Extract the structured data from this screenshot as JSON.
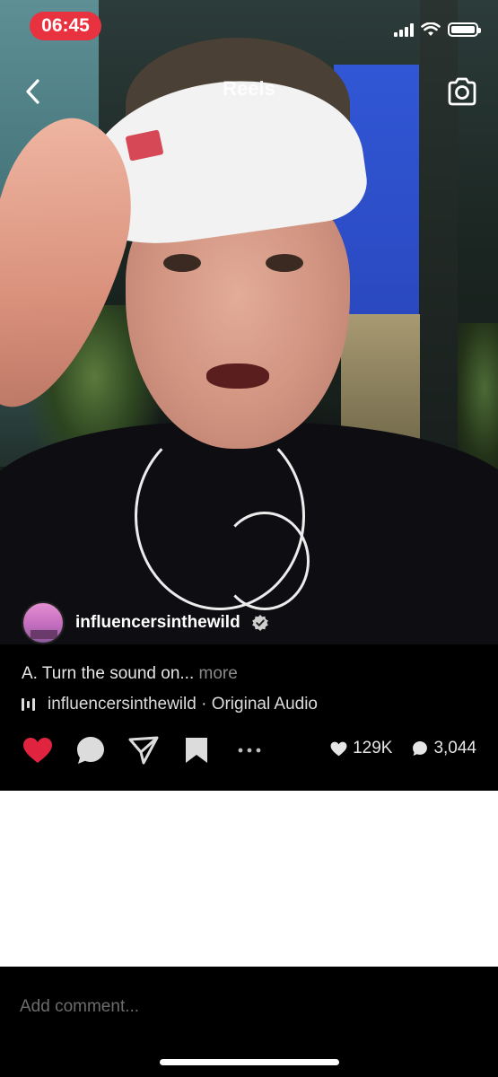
{
  "status_bar": {
    "time": "06:45"
  },
  "header": {
    "title": "Reels",
    "back_icon": "chevron-left-icon",
    "camera_icon": "camera-icon"
  },
  "post": {
    "author": "influencersinthewild",
    "verified": true,
    "caption": "A. Turn the sound on...",
    "more_label": "more",
    "audio": "influencersinthewild · Original Audio",
    "likes": "129K",
    "comments": "3,044",
    "liked": true,
    "like_color": "#e0243f"
  },
  "comment_box": {
    "placeholder": "Add comment..."
  }
}
